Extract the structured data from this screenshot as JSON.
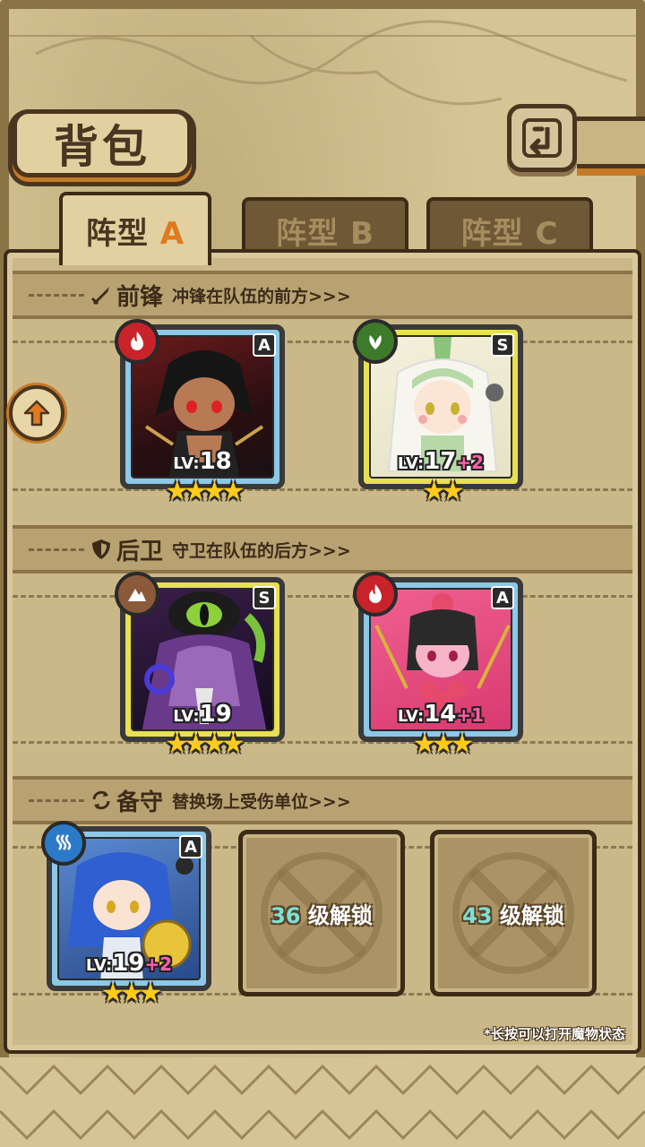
{
  "header": {
    "title": "背包",
    "back_icon": "back-arrow-icon"
  },
  "tabs": [
    {
      "label": "阵型",
      "suffix": "A",
      "active": true
    },
    {
      "label": "阵型",
      "suffix": "B",
      "active": false
    },
    {
      "label": "阵型",
      "suffix": "C",
      "active": false
    }
  ],
  "sections": {
    "front": {
      "title": "前锋",
      "desc": "冲锋在队伍的前方>>>",
      "icon": "sword-icon"
    },
    "back": {
      "title": "后卫",
      "desc": "守卫在队伍的后方>>>",
      "icon": "shield-icon"
    },
    "reserve": {
      "title": "备守",
      "desc": "替换场上受伤单位>>>",
      "icon": "swap-icon"
    }
  },
  "cards": {
    "front_1": {
      "rank": "A",
      "element": "fire-icon",
      "lv_label": "LV:",
      "level": "18",
      "bonus": "",
      "stars": "★★★★",
      "star_count": 4
    },
    "front_2": {
      "rank": "S",
      "element": "leaf-icon",
      "lv_label": "LV:",
      "level": "17",
      "bonus": "+2",
      "stars": "★★",
      "star_count": 2
    },
    "back_1": {
      "rank": "S",
      "element": "earth-icon",
      "lv_label": "LV:",
      "level": "19",
      "bonus": "",
      "stars": "★★★★",
      "star_count": 4
    },
    "back_2": {
      "rank": "A",
      "element": "fire-icon",
      "lv_label": "LV:",
      "level": "14",
      "bonus": "+1",
      "stars": "★★★",
      "star_count": 3
    },
    "reserve_1": {
      "rank": "A",
      "element": "water-icon",
      "lv_label": "LV:",
      "level": "19",
      "bonus": "+2",
      "stars": "★★★",
      "star_count": 3
    }
  },
  "locked_slots": [
    {
      "level": "36",
      "text": " 级解锁"
    },
    {
      "level": "43",
      "text": " 级解锁"
    }
  ],
  "hint": "*长按可以打开魔物状态",
  "colors": {
    "fire": "#c8222a",
    "leaf": "#3d7a2a",
    "earth": "#8a5a3a",
    "water": "#2a7ac8",
    "accent": "#e07a1e"
  }
}
